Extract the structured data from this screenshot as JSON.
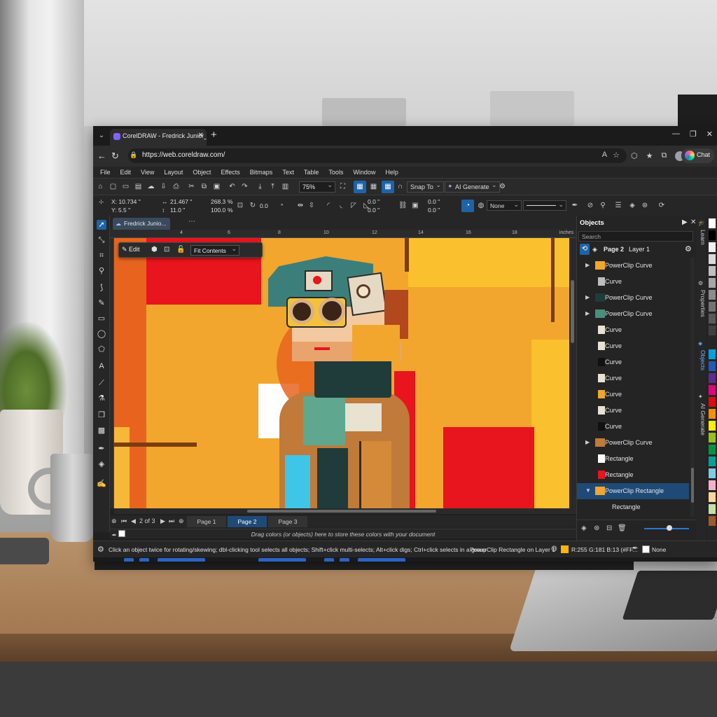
{
  "browser": {
    "tab_title": "CorelDRAW - Fredrick Junior_Robo",
    "url": "https://web.coreldraw.com/",
    "chat_label": "Chat"
  },
  "menu": [
    "File",
    "Edit",
    "View",
    "Layout",
    "Object",
    "Effects",
    "Bitmaps",
    "Text",
    "Table",
    "Tools",
    "Window",
    "Help"
  ],
  "toolbar": {
    "zoom": "75%",
    "snap_to": "Snap To",
    "ai_generate": "AI Generate"
  },
  "properties": {
    "x": "X: 10.734 \"",
    "y": "Y: 5.5 \"",
    "width": "21.467 \"",
    "height": "11.0 \"",
    "scale_w": "268.3",
    "scale_h": "100.0",
    "pct_1": "%",
    "pct_2": "%",
    "rotation": "0.0",
    "deg": "°",
    "skew_1a": "0.0 \"",
    "skew_1b": "0.0 \"",
    "skew_2a": "0.0 \"",
    "skew_2b": "0.0 \"",
    "fill": "None"
  },
  "document_tab": "Fredrick Junio...",
  "ruler": {
    "ticks": [
      "4",
      "6",
      "8",
      "10",
      "12",
      "14",
      "16",
      "18"
    ],
    "unit": "inches"
  },
  "floating_toolbar": {
    "edit": "Edit",
    "fit_contents": "Fit Contents"
  },
  "page_nav": {
    "counter": "2 of 3",
    "pages": [
      "Page 1",
      "Page 2",
      "Page 3"
    ],
    "active_page": 1
  },
  "color_hint": "Drag colors (or objects) here to store these colors with your document",
  "status": {
    "hint": "Click an object twice for rotating/skewing; dbl-clicking tool selects all objects; Shift+click multi-selects; Alt+click digs; Ctrl+click selects in a group",
    "object": "PowerClip Rectangle on Layer 1",
    "fill": "R:255 G:181 B:13 (#FF...",
    "outline": "None",
    "fill_color": "#ffb50d"
  },
  "objects_panel": {
    "title": "Objects",
    "search_placeholder": "Search",
    "page": "Page 2",
    "layer": "Layer 1",
    "items": [
      {
        "label": "PowerClip Curve",
        "expandable": true,
        "expanded": false,
        "selected": false,
        "thumb": "#f2a62d"
      },
      {
        "label": "Curve",
        "expandable": false,
        "expanded": false,
        "selected": false,
        "thumb": "#bdbdbd"
      },
      {
        "label": "PowerClip Curve",
        "expandable": true,
        "expanded": false,
        "selected": false,
        "thumb": "#1f3b3a"
      },
      {
        "label": "PowerClip Curve",
        "expandable": true,
        "expanded": false,
        "selected": false,
        "thumb": "#4a8f7a"
      },
      {
        "label": "Curve",
        "expandable": false,
        "expanded": false,
        "selected": false,
        "thumb": "#e8e2d0"
      },
      {
        "label": "Curve",
        "expandable": false,
        "expanded": false,
        "selected": false,
        "thumb": "#e8e2d0"
      },
      {
        "label": "Curve",
        "expandable": false,
        "expanded": false,
        "selected": false,
        "thumb": "#111111"
      },
      {
        "label": "Curve",
        "expandable": false,
        "expanded": false,
        "selected": false,
        "thumb": "#e8e2d0"
      },
      {
        "label": "Curve",
        "expandable": false,
        "expanded": false,
        "selected": false,
        "thumb": "#f2a62d"
      },
      {
        "label": "Curve",
        "expandable": false,
        "expanded": false,
        "selected": false,
        "thumb": "#e8e2d0"
      },
      {
        "label": "Curve",
        "expandable": false,
        "expanded": false,
        "selected": false,
        "thumb": "#111111"
      },
      {
        "label": "PowerClip Curve",
        "expandable": true,
        "expanded": false,
        "selected": false,
        "thumb": "#c07a3a"
      },
      {
        "label": "Rectangle",
        "expandable": false,
        "expanded": false,
        "selected": false,
        "thumb": "#ffffff"
      },
      {
        "label": "Rectangle",
        "expandable": false,
        "expanded": false,
        "selected": false,
        "thumb": "#e8141e"
      },
      {
        "label": "PowerClip Rectangle",
        "expandable": true,
        "expanded": true,
        "selected": true,
        "thumb": "#f2a62d"
      },
      {
        "label": "Rectangle",
        "expandable": false,
        "expanded": false,
        "selected": false,
        "thumb": ""
      }
    ]
  },
  "dock_tabs": [
    {
      "label": "Learn",
      "active": false
    },
    {
      "label": "Properties",
      "active": false
    },
    {
      "label": "Objects",
      "active": true
    },
    {
      "label": "AI Generate",
      "active": false
    }
  ],
  "palette": [
    "#ffffff",
    "#000000",
    "#f0f0f0",
    "#d9d9d9",
    "#bfbfbf",
    "#a6a6a6",
    "#8c8c8c",
    "#737373",
    "#595959",
    "#404040",
    "#262626",
    "#00a0e3",
    "#1e5bb8",
    "#5b2d90",
    "#e6007e",
    "#e30613",
    "#f39200",
    "#ffed00",
    "#95c11f",
    "#009640",
    "#00a19a",
    "#7fcbe6",
    "#f5b1cc",
    "#fdd79a",
    "#c5e0a5",
    "#9c5b2e"
  ],
  "colors": {
    "accent": "#1e63a8",
    "selection": "#1f4a78",
    "panel_bg": "#242424"
  }
}
